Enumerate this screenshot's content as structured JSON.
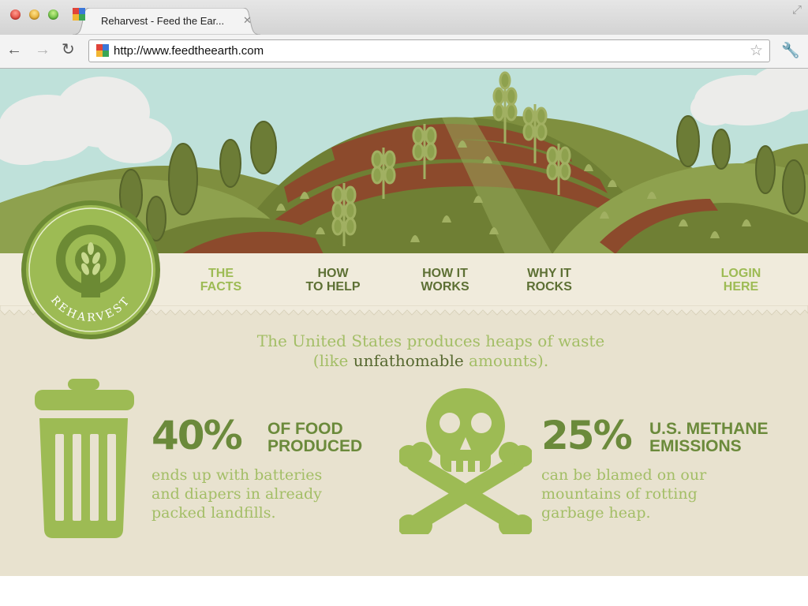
{
  "browser": {
    "tab_title": "Reharvest - Feed the Ear...",
    "url": "http://www.feedtheearth.com",
    "tab_close": "✕",
    "back_glyph": "←",
    "forward_glyph": "→",
    "reload_glyph": "↻",
    "star_glyph": "☆",
    "wrench_glyph": "🔧",
    "resize_glyph": "⤢"
  },
  "site": {
    "logo_text": "REHARVEST",
    "nav": [
      {
        "line1": "THE",
        "line2": "FACTS"
      },
      {
        "line1": "HOW",
        "line2": "TO HELP"
      },
      {
        "line1": "HOW IT",
        "line2": "WORKS"
      },
      {
        "line1": "WHY IT",
        "line2": "ROCKS"
      },
      {
        "line1": "LOGIN",
        "line2": "HERE"
      }
    ],
    "intro": {
      "line1": "The United States produces heaps of waste",
      "line2_a": "(like ",
      "line2_b": "unfathomable",
      "line2_c": " amounts)."
    },
    "stats": [
      {
        "percent": "40%",
        "label_line1": "OF FOOD",
        "label_line2": "PRODUCED",
        "desc": [
          "ends up with batteries",
          "and diapers in already",
          "packed landfills."
        ],
        "icon": "trash-can-icon"
      },
      {
        "percent": "25%",
        "label_line1": "U.S. METHANE",
        "label_line2": "EMISSIONS",
        "desc": [
          "can be blamed on our",
          "mountains of rotting",
          "garbage heap."
        ],
        "icon": "skull-crossbones-icon"
      }
    ]
  },
  "colors": {
    "sky": "#bfe1da",
    "hill_dark": "#6f7f34",
    "hill_light": "#8ea14e",
    "soil": "#8c4a2c",
    "accent_light": "#9dbb54",
    "accent_dark": "#5d7034",
    "stat_green": "#6b8a3b",
    "background": "#e8e2cf"
  }
}
